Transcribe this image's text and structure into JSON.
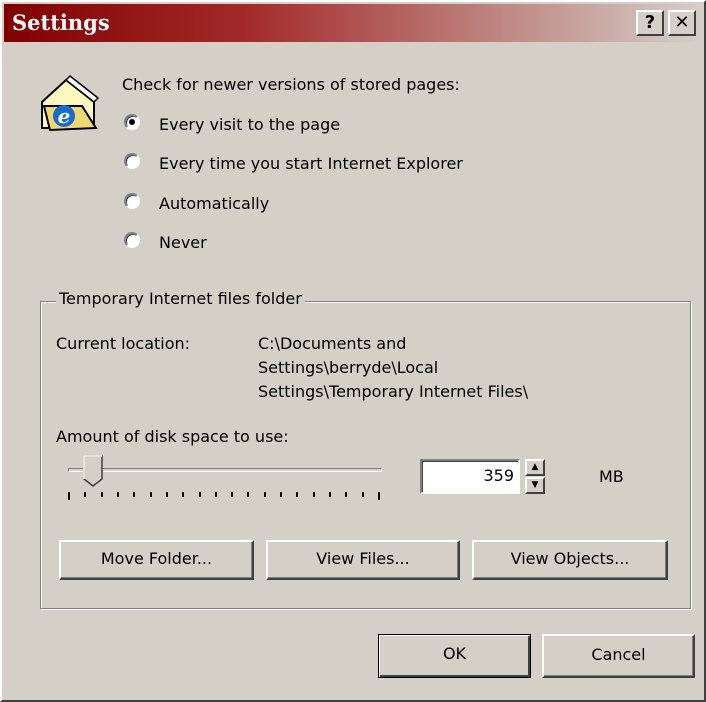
{
  "window": {
    "title": "Settings",
    "help_label": "?",
    "close_label": "✕"
  },
  "icon": {
    "name": "internet-explorer-folder-icon",
    "glyph": "e"
  },
  "check": {
    "label": "Check for newer versions of stored pages:",
    "options": [
      {
        "label": "Every visit to the page",
        "selected": true
      },
      {
        "label": "Every time you start Internet Explorer",
        "selected": false
      },
      {
        "label": "Automatically",
        "selected": false
      },
      {
        "label": "Never",
        "selected": false
      }
    ]
  },
  "folder_group": {
    "legend": "Temporary Internet files folder",
    "location_label": "Current location:",
    "location_lines": [
      "C:\\Documents and",
      "Settings\\berryde\\Local",
      "Settings\\Temporary Internet Files\\"
    ],
    "disk_label": "Amount of disk space to use:",
    "slider_fraction": 0.05,
    "disk_value": "359",
    "unit": "MB",
    "buttons": {
      "move": "Move Folder...",
      "view_files": "View Files...",
      "view_objects": "View Objects..."
    }
  },
  "footer": {
    "ok": "OK",
    "cancel": "Cancel"
  },
  "colors": {
    "titlebar": "#800000",
    "face": "#d4d0c8"
  }
}
